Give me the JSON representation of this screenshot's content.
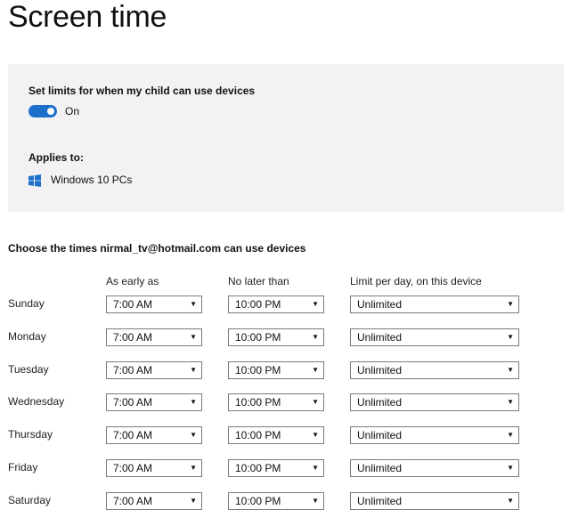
{
  "page": {
    "title": "Screen time"
  },
  "limits": {
    "label": "Set limits for when my child can use devices",
    "toggle_state": "On",
    "toggle_on": true,
    "accent_color": "#1e6fcc",
    "applies_label": "Applies to:",
    "device_icon": "windows-logo-icon",
    "device_name": "Windows 10 PCs"
  },
  "schedule": {
    "heading": "Choose the times nirmal_tv@hotmail.com can use devices",
    "columns": [
      "As early as",
      "No later than",
      "Limit per day, on this device"
    ],
    "rows": [
      {
        "day": "Sunday",
        "early": "7:00 AM",
        "late": "10:00 PM",
        "limit": "Unlimited"
      },
      {
        "day": "Monday",
        "early": "7:00 AM",
        "late": "10:00 PM",
        "limit": "Unlimited"
      },
      {
        "day": "Tuesday",
        "early": "7:00 AM",
        "late": "10:00 PM",
        "limit": "Unlimited"
      },
      {
        "day": "Wednesday",
        "early": "7:00 AM",
        "late": "10:00 PM",
        "limit": "Unlimited"
      },
      {
        "day": "Thursday",
        "early": "7:00 AM",
        "late": "10:00 PM",
        "limit": "Unlimited"
      },
      {
        "day": "Friday",
        "early": "7:00 AM",
        "late": "10:00 PM",
        "limit": "Unlimited"
      },
      {
        "day": "Saturday",
        "early": "7:00 AM",
        "late": "10:00 PM",
        "limit": "Unlimited"
      }
    ]
  }
}
